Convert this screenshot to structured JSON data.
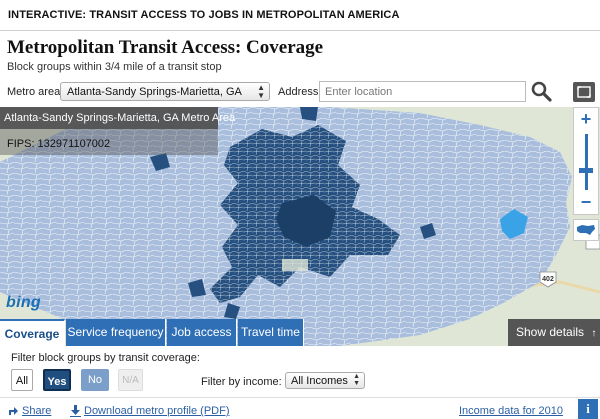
{
  "header": {
    "banner": "INTERACTIVE: TRANSIT ACCESS TO JOBS IN METROPOLITAN AMERICA"
  },
  "page": {
    "title": "Metropolitan Transit Access: Coverage",
    "subtitle": "Block groups within 3/4 mile of a transit stop"
  },
  "controls": {
    "metro_label": "Metro area",
    "metro_selected": "Atlanta-Sandy Springs-Marietta, GA",
    "address_label": "Address",
    "address_placeholder": "Enter location",
    "address_value": ""
  },
  "map": {
    "info_name": "Atlanta-Sandy Springs-Marietta, GA Metro Area",
    "info_fips": "FIPS: 132971107002",
    "logo": "bing",
    "road_labels": [
      "402"
    ],
    "colors": {
      "covered": "#25507f",
      "not_covered": "#a8bedc",
      "highlight": "#3aa3e8",
      "basemap": "#dfe6d6"
    }
  },
  "tabs": [
    {
      "label": "Coverage",
      "active": true
    },
    {
      "label": "Service frequency",
      "active": false
    },
    {
      "label": "Job access",
      "active": false
    },
    {
      "label": "Travel time",
      "active": false
    }
  ],
  "details_button": "Show details",
  "filters": {
    "coverage_label": "Filter block groups by transit coverage:",
    "buttons": [
      "All",
      "Yes",
      "No",
      "N/A"
    ],
    "selected": "Yes",
    "income_label": "Filter by income:",
    "income_selected": "All Incomes"
  },
  "footer": {
    "share": "Share",
    "download": "Download metro profile (PDF)",
    "income_data": "Income data for 2010",
    "info": "i"
  },
  "icons": {
    "search": "search-icon",
    "fullscreen": "fullscreen-icon",
    "zoom_in": "plus-icon",
    "zoom_out": "minus-icon",
    "us_map": "us-map-icon",
    "share": "share-icon",
    "download": "download-icon",
    "info": "info-icon"
  }
}
